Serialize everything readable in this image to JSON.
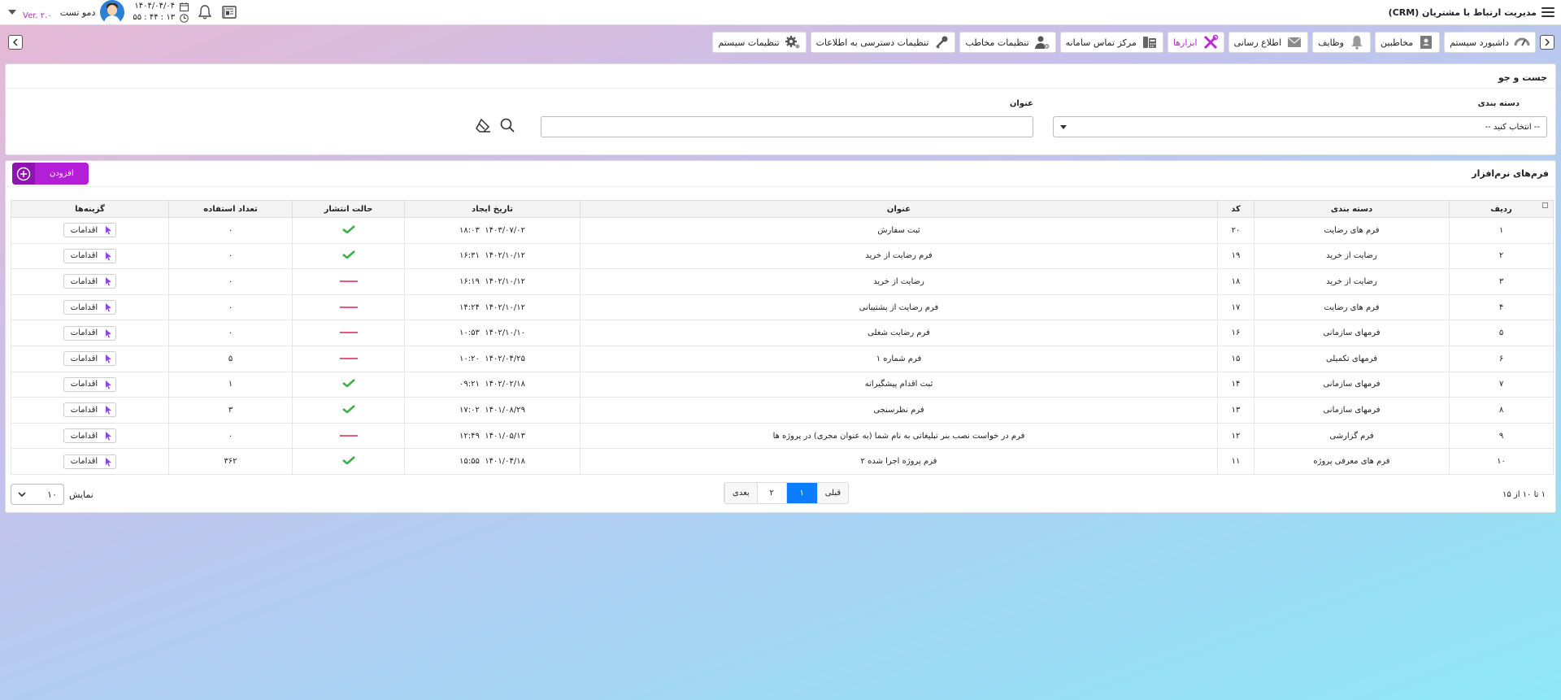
{
  "app": {
    "title": "مدیریت ارتباط با مشتریان (CRM)",
    "version": "Ver. ۲.۰"
  },
  "user": {
    "name": "دمو تست"
  },
  "clock": {
    "date": "۱۴۰۴/۰۴/۰۴",
    "time": "۱۳ : ۴۴ : ۵۵"
  },
  "menu": [
    {
      "label": "داشبورد سیستم",
      "icon": "dashboard-gauge-icon"
    },
    {
      "label": "مخاطبین",
      "icon": "contact-card-icon"
    },
    {
      "label": "وظایف",
      "icon": "bell-icon"
    },
    {
      "label": "اطلاع رسانی",
      "icon": "envelope-icon"
    },
    {
      "label": "ابزارها",
      "icon": "tools-icon",
      "active": true
    },
    {
      "label": "مرکز تماس سامانه",
      "icon": "phone-icon"
    },
    {
      "label": "تنظیمات مخاطب",
      "icon": "user-settings-icon"
    },
    {
      "label": "تنظیمات دسترسی به اطلاعات",
      "icon": "key-icon"
    },
    {
      "label": "تنظیمات سیستم",
      "icon": "gear-icon"
    }
  ],
  "search": {
    "title": "جست و جو",
    "category_label": "دسته بندی",
    "category_value": "-- انتخاب کنید --",
    "title_label": "عنوان",
    "title_value": ""
  },
  "grid": {
    "title": "فرم‌های نرم‌افزار",
    "add_label": "افزودن",
    "columns": [
      "ردیف",
      "دسته بندی",
      "کد",
      "عنوان",
      "تاریخ ایجاد",
      "حالت انتشار",
      "تعداد استفاده",
      "گزینه‌ها"
    ],
    "action_label": "اقدامات",
    "rows": [
      {
        "row": "۱",
        "category": "فرم های رضایت",
        "code": "۲۰",
        "title": "ثبت سفارش",
        "date": "۱۴۰۳/۰۷/۰۲",
        "time": "۱۸:۰۳",
        "published": true,
        "uses": "۰"
      },
      {
        "row": "۲",
        "category": "رضایت از خرید",
        "code": "۱۹",
        "title": "فرم رضایت از خرید",
        "date": "۱۴۰۲/۱۰/۱۲",
        "time": "۱۶:۳۱",
        "published": true,
        "uses": "۰"
      },
      {
        "row": "۳",
        "category": "رضایت از خرید",
        "code": "۱۸",
        "title": "رضایت از خرید",
        "date": "۱۴۰۲/۱۰/۱۲",
        "time": "۱۶:۱۹",
        "published": false,
        "uses": "۰"
      },
      {
        "row": "۴",
        "category": "فرم های رضایت",
        "code": "۱۷",
        "title": "فرم رضایت از پشتیبانی",
        "date": "۱۴۰۲/۱۰/۱۲",
        "time": "۱۴:۲۴",
        "published": false,
        "uses": "۰"
      },
      {
        "row": "۵",
        "category": "فرمهای سازمانی",
        "code": "۱۶",
        "title": "فرم رضایت شغلی",
        "date": "۱۴۰۲/۱۰/۱۰",
        "time": "۱۰:۵۳",
        "published": false,
        "uses": "۰"
      },
      {
        "row": "۶",
        "category": "فرمهای تکمیلی",
        "code": "۱۵",
        "title": "فرم شماره ۱",
        "date": "۱۴۰۲/۰۴/۲۵",
        "time": "۱۰:۲۰",
        "published": false,
        "uses": "۵"
      },
      {
        "row": "۷",
        "category": "فرمهای سازمانی",
        "code": "۱۴",
        "title": "ثبت اقدام پیشگیرانه",
        "date": "۱۴۰۲/۰۲/۱۸",
        "time": "۰۹:۲۱",
        "published": true,
        "uses": "۱"
      },
      {
        "row": "۸",
        "category": "فرمهای سازمانی",
        "code": "۱۳",
        "title": "فرم نظرسنجی",
        "date": "۱۴۰۱/۰۸/۲۹",
        "time": "۱۷:۰۲",
        "published": true,
        "uses": "۳"
      },
      {
        "row": "۹",
        "category": "فرم گزارشی",
        "code": "۱۲",
        "title": "فرم در خواست نصب بنر تبلیغاتی به نام شما (به عنوان مجری) در پروژه ها",
        "date": "۱۴۰۱/۰۵/۱۳",
        "time": "۱۲:۴۹",
        "published": false,
        "uses": "۰"
      },
      {
        "row": "۱۰",
        "category": "فرم های معرفی پروژه",
        "code": "۱۱",
        "title": "فرم پروژه اجرا شده ۲",
        "date": "۱۴۰۱/۰۴/۱۸",
        "time": "۱۵:۵۵",
        "published": true,
        "uses": "۳۶۲"
      }
    ]
  },
  "pagination": {
    "range_text": "۱ تا ۱۰ از ۱۵",
    "prev": "قبلی",
    "current": "۱",
    "next_page": "۲",
    "next": "بعدی",
    "show_label": "نمایش",
    "page_size": "۱۰"
  },
  "colors": {
    "accent": "#c026d3",
    "primary": "#0d7dff",
    "check": "#3fae49",
    "dash": "#e55a7a"
  }
}
